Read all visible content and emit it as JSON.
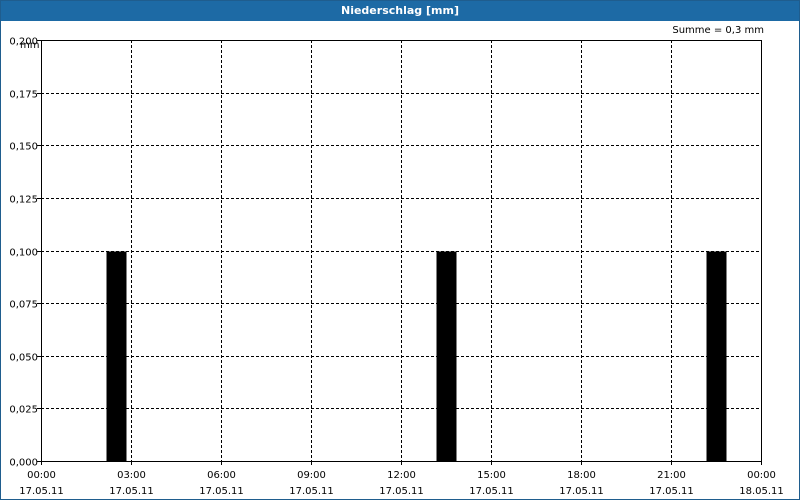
{
  "window": {
    "title": "Niederschlag [mm]"
  },
  "summary": {
    "text": "Summe = 0,3 mm"
  },
  "chart_data": {
    "type": "bar",
    "ylabel": "mm",
    "ylim": [
      0,
      0.2
    ],
    "yticks": [
      "0,000",
      "0,025",
      "0,050",
      "0,075",
      "0,100",
      "0,125",
      "0,150",
      "0,175",
      "0,200"
    ],
    "xlim_hours": [
      0,
      24
    ],
    "xticks": [
      {
        "time": "00:00",
        "date": "17.05.11"
      },
      {
        "time": "03:00",
        "date": "17.05.11"
      },
      {
        "time": "06:00",
        "date": "17.05.11"
      },
      {
        "time": "09:00",
        "date": "17.05.11"
      },
      {
        "time": "12:00",
        "date": "17.05.11"
      },
      {
        "time": "15:00",
        "date": "17.05.11"
      },
      {
        "time": "18:00",
        "date": "17.05.11"
      },
      {
        "time": "21:00",
        "date": "17.05.11"
      },
      {
        "time": "00:00",
        "date": "18.05.11"
      }
    ],
    "bars": [
      {
        "x_hours": 2.5,
        "value": 0.1
      },
      {
        "x_hours": 13.5,
        "value": 0.1
      },
      {
        "x_hours": 22.5,
        "value": 0.1
      }
    ],
    "grid": true,
    "bar_color": "#000000"
  }
}
